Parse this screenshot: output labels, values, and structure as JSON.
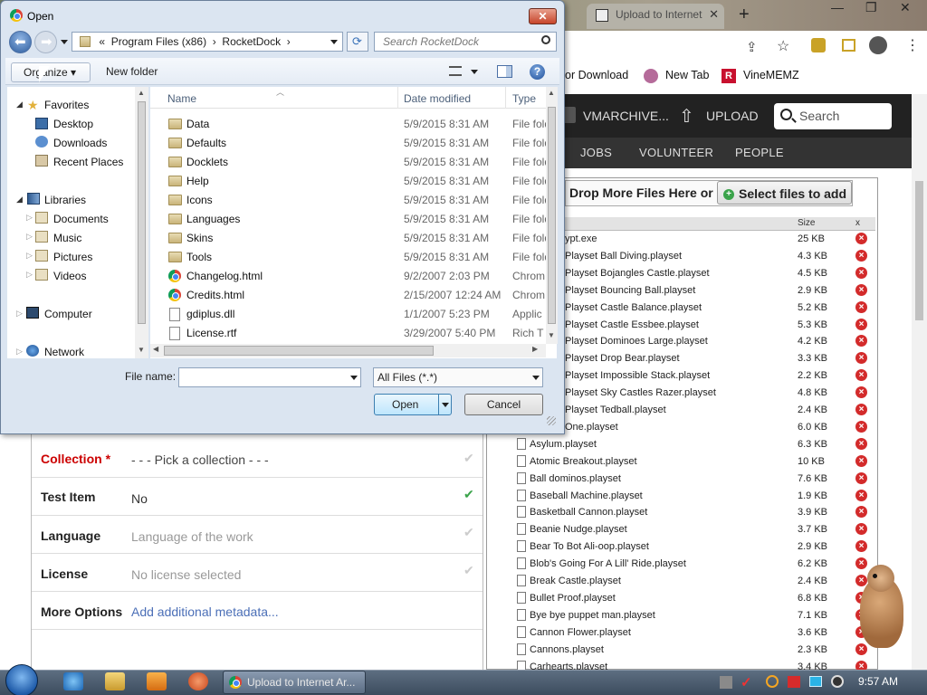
{
  "dialog": {
    "title": "Open",
    "close_glyph": "✕",
    "path": [
      "«",
      "Program Files (x86)",
      "›",
      "RocketDock",
      "›"
    ],
    "search_placeholder": "Search RocketDock",
    "organize": "Organize ▾",
    "new_folder": "New folder",
    "nav": {
      "favorites": "Favorites",
      "desktop": "Desktop",
      "downloads": "Downloads",
      "recent": "Recent Places",
      "libraries": "Libraries",
      "documents": "Documents",
      "music": "Music",
      "pictures": "Pictures",
      "videos": "Videos",
      "computer": "Computer",
      "network": "Network"
    },
    "columns": {
      "name": "Name",
      "date": "Date modified",
      "type": "Type"
    },
    "files": [
      {
        "name": "Data",
        "date": "5/9/2015 8:31 AM",
        "type": "File fold",
        "icon": "folder"
      },
      {
        "name": "Defaults",
        "date": "5/9/2015 8:31 AM",
        "type": "File fold",
        "icon": "folder"
      },
      {
        "name": "Docklets",
        "date": "5/9/2015 8:31 AM",
        "type": "File fold",
        "icon": "folder"
      },
      {
        "name": "Help",
        "date": "5/9/2015 8:31 AM",
        "type": "File fold",
        "icon": "folder"
      },
      {
        "name": "Icons",
        "date": "5/9/2015 8:31 AM",
        "type": "File fold",
        "icon": "folder"
      },
      {
        "name": "Languages",
        "date": "5/9/2015 8:31 AM",
        "type": "File fold",
        "icon": "folder"
      },
      {
        "name": "Skins",
        "date": "5/9/2015 8:31 AM",
        "type": "File fold",
        "icon": "folder"
      },
      {
        "name": "Tools",
        "date": "5/9/2015 8:31 AM",
        "type": "File fold",
        "icon": "folder"
      },
      {
        "name": "Changelog.html",
        "date": "9/2/2007 2:03 PM",
        "type": "Chrom",
        "icon": "chrome"
      },
      {
        "name": "Credits.html",
        "date": "2/15/2007 12:24 AM",
        "type": "Chrom",
        "icon": "chrome"
      },
      {
        "name": "gdiplus.dll",
        "date": "1/1/2007 5:23 PM",
        "type": "Applic",
        "icon": "doc"
      },
      {
        "name": "License.rtf",
        "date": "3/29/2007 5:40 PM",
        "type": "Rich T",
        "icon": "doc"
      }
    ],
    "file_name_label": "File name:",
    "file_name_value": "",
    "file_type": "All Files (*.*)",
    "open_label": "Open",
    "cancel_label": "Cancel"
  },
  "browser": {
    "tab_title": "Upload to Internet",
    "bookmarks": [
      "or Download",
      "New Tab",
      "VineMEMZ"
    ],
    "header_user": "VMARCHIVE...",
    "upload": "UPLOAD",
    "search": "Search",
    "nav": [
      "JOBS",
      "VOLUNTEER",
      "PEOPLE"
    ],
    "drop_text": "Drop More Files Here or",
    "select_files": "Select files to add",
    "size_header": "Size",
    "x_header": "x",
    "files": [
      {
        "name": "ypt.exe",
        "size": "25 KB"
      },
      {
        "name": "Playset Ball Diving.playset",
        "size": "4.3 KB"
      },
      {
        "name": "Playset Bojangles Castle.playset",
        "size": "4.5 KB"
      },
      {
        "name": "Playset Bouncing Ball.playset",
        "size": "2.9 KB"
      },
      {
        "name": "Playset Castle Balance.playset",
        "size": "5.2 KB"
      },
      {
        "name": "Playset Castle Essbee.playset",
        "size": "5.3 KB"
      },
      {
        "name": "Playset Dominoes Large.playset",
        "size": "4.2 KB"
      },
      {
        "name": "Playset Drop Bear.playset",
        "size": "3.3 KB"
      },
      {
        "name": "Playset Impossible Stack.playset",
        "size": "2.2 KB"
      },
      {
        "name": "Playset Sky Castles Razer.playset",
        "size": "4.8 KB"
      },
      {
        "name": "Playset Tedball.playset",
        "size": "2.4 KB"
      },
      {
        "name": "One.playset",
        "size": "6.0 KB"
      },
      {
        "name": "Asylum.playset",
        "size": "6.3 KB"
      },
      {
        "name": "Atomic Breakout.playset",
        "size": "10 KB"
      },
      {
        "name": "Ball dominos.playset",
        "size": "7.6 KB"
      },
      {
        "name": "Baseball Machine.playset",
        "size": "1.9 KB"
      },
      {
        "name": "Basketball Cannon.playset",
        "size": "3.9 KB"
      },
      {
        "name": "Beanie Nudge.playset",
        "size": "3.7 KB"
      },
      {
        "name": "Bear To Bot Ali-oop.playset",
        "size": "2.9 KB"
      },
      {
        "name": "Blob's Going For A Lill' Ride.playset",
        "size": "6.2 KB"
      },
      {
        "name": "Break Castle.playset",
        "size": "2.4 KB"
      },
      {
        "name": "Bullet Proof.playset",
        "size": "6.8 KB"
      },
      {
        "name": "Bye bye puppet man.playset",
        "size": "7.1 KB"
      },
      {
        "name": "Cannon Flower.playset",
        "size": "3.6 KB"
      },
      {
        "name": "Cannons.playset",
        "size": "2.3 KB"
      },
      {
        "name": "Carhearts.playset",
        "size": "3.4 KB"
      }
    ],
    "metadata": [
      {
        "label": "Collection",
        "required": "*",
        "value": "- - - Pick a collection - - -"
      },
      {
        "label": "Test Item",
        "value": "No"
      },
      {
        "label": "Language",
        "value": "Language of the work"
      },
      {
        "label": "License",
        "value": "No license selected"
      },
      {
        "label": "More Options",
        "value": "Add additional metadata..."
      }
    ]
  },
  "taskbar": {
    "active_window": "Upload to Internet Ar...",
    "clock": "9:57 AM"
  },
  "colors": {
    "required": "#cc0000",
    "link": "#4b6fb7",
    "remove": "#d32b2b"
  }
}
